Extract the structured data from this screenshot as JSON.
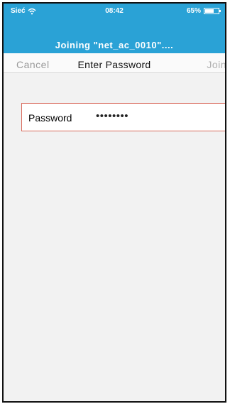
{
  "status_bar": {
    "carrier": "Sieć",
    "time": "08:42",
    "battery_percent": "65%",
    "battery_level": 0.65,
    "wifi_icon": "wifi-icon",
    "battery_icon": "battery-icon"
  },
  "banner": {
    "joining_text": "Joining \"net_ac_0010\"...."
  },
  "nav": {
    "cancel_label": "Cancel",
    "title": "Enter Password",
    "join_label": "Join"
  },
  "password_field": {
    "label": "Password",
    "masked_value": "••••••••"
  },
  "colors": {
    "accent": "#2aa2d6",
    "field_border": "#d86a5c"
  }
}
